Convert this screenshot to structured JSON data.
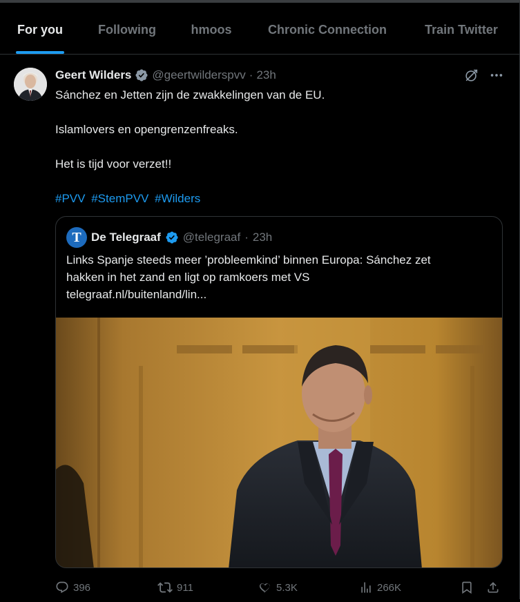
{
  "tabs": [
    {
      "label": "For you",
      "active": true
    },
    {
      "label": "Following",
      "active": false
    },
    {
      "label": "hmoos",
      "active": false
    },
    {
      "label": "Chronic Connection",
      "active": false
    },
    {
      "label": "Train Twitter",
      "active": false
    }
  ],
  "tweet": {
    "author_name": "Geert Wilders",
    "handle": "@geertwilderspvv",
    "separator": "·",
    "time": "23h",
    "paragraphs": [
      "Sánchez en Jetten zijn de zwakkelingen van de EU.",
      "Islamlovers en opengrenzenfreaks.",
      "Het is tijd voor verzet!!"
    ],
    "hashtags": [
      "#PVV",
      "#StemPVV",
      "#Wilders"
    ],
    "verified_color": "#8b98a5"
  },
  "quote": {
    "author_name": "De Telegraaf",
    "handle": "@telegraaf",
    "separator": "·",
    "time": "23h",
    "text_line1": "Links Spanje steeds meer ’probleemkind’ binnen Europa: Sánchez zet",
    "text_line2": "hakken in het zand en ligt op ramkoers met VS",
    "link": "telegraaf.nl/buitenland/lin...",
    "verified_color": "#1d9bf0",
    "logo_letter": "T"
  },
  "actions": {
    "replies": "396",
    "reposts": "911",
    "likes": "5.3K",
    "views": "266K"
  },
  "icons": [
    "grok-icon",
    "more-icon",
    "reply-icon",
    "repost-icon",
    "like-icon",
    "views-icon",
    "bookmark-icon",
    "share-icon"
  ],
  "colors": {
    "accent": "#1d9bf0",
    "muted": "#71767b",
    "text": "#e7e9ea",
    "border": "#2f3336"
  }
}
